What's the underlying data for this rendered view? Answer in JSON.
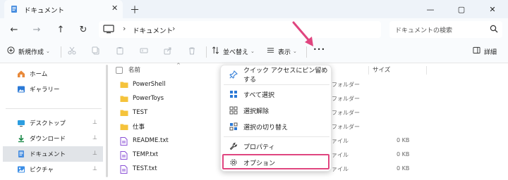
{
  "window": {
    "tab_title": "ドキュメント",
    "tab_close": "✕",
    "new_tab": "＋",
    "minimize": "—",
    "maximize": "▢",
    "close": "✕"
  },
  "nav": {
    "back": "←",
    "forward": "→",
    "up": "↑",
    "refresh": "↻",
    "chevron": "›",
    "breadcrumb": "ドキュメント",
    "search_placeholder": "ドキュメントの検索"
  },
  "toolbar": {
    "new_label": "新規作成",
    "sort_label": "並べ替え",
    "view_label": "表示",
    "more_label": "•••",
    "details_label": "詳細",
    "chev": "⌄"
  },
  "sidebar": {
    "items": [
      {
        "label": "ホーム",
        "icon": "home-icon"
      },
      {
        "label": "ギャラリー",
        "icon": "gallery-icon"
      },
      {
        "label": "デスクトップ",
        "icon": "desktop-icon",
        "pinned": true
      },
      {
        "label": "ダウンロード",
        "icon": "download-icon",
        "pinned": true
      },
      {
        "label": "ドキュメント",
        "icon": "documents-icon",
        "pinned": true,
        "active": true
      },
      {
        "label": "ピクチャ",
        "icon": "pictures-icon",
        "pinned": true
      }
    ],
    "pin_glyph": "📌"
  },
  "columns": {
    "name": "名前",
    "size": "サイズ",
    "sort_glyph": "^"
  },
  "files": [
    {
      "name": "PowerShell",
      "type": "フォルダー",
      "size": "",
      "kind": "folder"
    },
    {
      "name": "PowerToys",
      "type": "フォルダー",
      "size": "",
      "kind": "folder"
    },
    {
      "name": "TEST",
      "type": "フォルダー",
      "size": "",
      "kind": "folder"
    },
    {
      "name": "仕事",
      "type": "フォルダー",
      "size": "",
      "kind": "folder"
    },
    {
      "name": "README.txt",
      "type": "ァイル",
      "size": "0 KB",
      "kind": "text"
    },
    {
      "name": "TEMP.txt",
      "type": "ァイル",
      "size": "0 KB",
      "kind": "text"
    },
    {
      "name": "TEST.txt",
      "type": "ァイル",
      "size": "0 KB",
      "kind": "text"
    }
  ],
  "menu": {
    "items": [
      {
        "label": "クイック アクセスにピン留めする",
        "icon": "pin-icon"
      },
      {
        "label": "すべて選択",
        "icon": "select-all-icon"
      },
      {
        "label": "選択解除",
        "icon": "select-none-icon"
      },
      {
        "label": "選択の切り替え",
        "icon": "invert-selection-icon"
      },
      {
        "label": "プロパティ",
        "icon": "properties-icon"
      },
      {
        "label": "オプション",
        "icon": "options-icon",
        "highlighted": true
      }
    ]
  },
  "colors": {
    "accent": "#e0457f",
    "folder": "#f5c33b",
    "blue": "#2b79d6"
  }
}
